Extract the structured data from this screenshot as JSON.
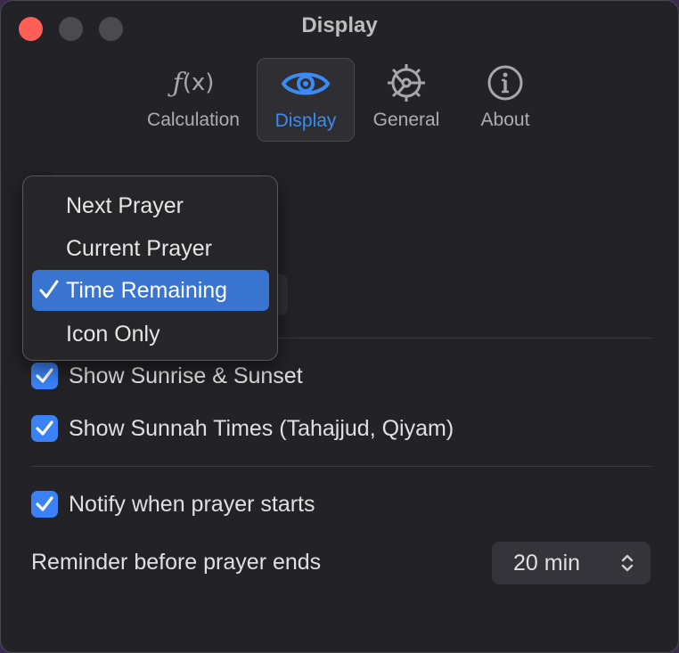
{
  "window": {
    "title": "Display"
  },
  "tabs": [
    {
      "label": "Calculation",
      "icon": "function-icon"
    },
    {
      "label": "Display",
      "icon": "eye-icon",
      "active": true
    },
    {
      "label": "General",
      "icon": "gear-icon"
    },
    {
      "label": "About",
      "icon": "info-icon"
    }
  ],
  "fx_icon": {
    "f": "ƒ",
    "x": "(x)"
  },
  "dropdown": {
    "options": [
      "Next Prayer",
      "Current Prayer",
      "Time Remaining",
      "Icon Only"
    ],
    "selected": "Time Remaining"
  },
  "settings": {
    "show_sunrise_sunset": {
      "label": "Show Sunrise & Sunset",
      "checked": true
    },
    "show_sunnah_times": {
      "label": "Show Sunnah Times (Tahajjud, Qiyam)",
      "checked": true
    },
    "notify_prayer_starts": {
      "label": "Notify when prayer starts",
      "checked": true
    },
    "reminder": {
      "label": "Reminder before prayer ends",
      "value": "20 min"
    }
  },
  "colors": {
    "accent": "#3a82f6",
    "close": "#ff5f57",
    "background": "#232226"
  }
}
